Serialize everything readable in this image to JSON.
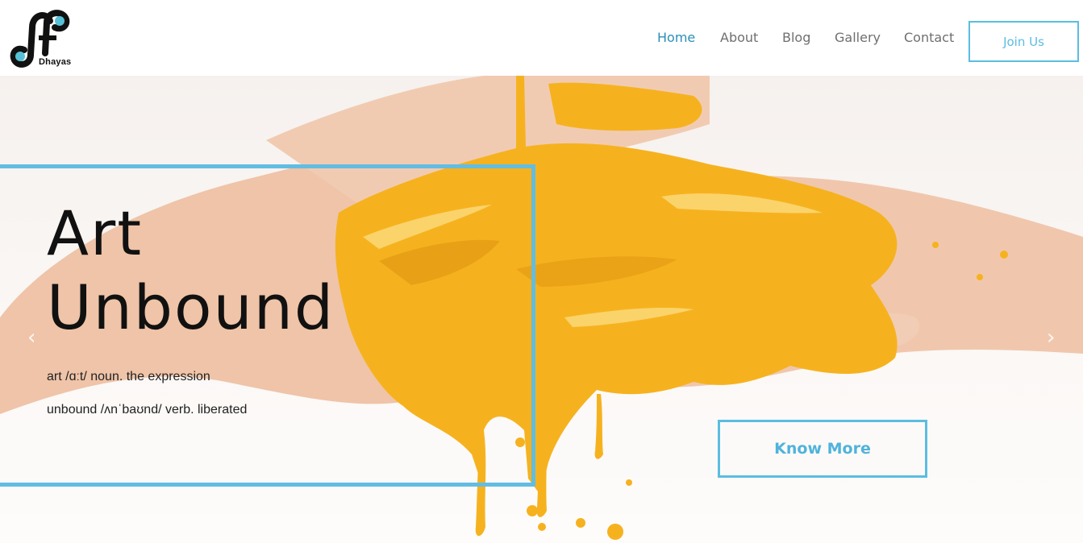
{
  "brand": {
    "name": "Dhayas",
    "logo_icon": "intertwined-jf-logo-icon"
  },
  "nav": {
    "items": [
      {
        "label": "Home",
        "active": true
      },
      {
        "label": "About",
        "active": false
      },
      {
        "label": "Blog",
        "active": false
      },
      {
        "label": "Gallery",
        "active": false
      },
      {
        "label": "Contact",
        "active": false
      }
    ],
    "join_label": "Join Us"
  },
  "hero": {
    "title_line1": "Art",
    "title_line2": "Unbound",
    "definition_1": "art /ɑːt/ noun. the expression",
    "definition_2": "unbound /ʌnˈbaʊnd/ verb. liberated",
    "cta_label": "Know More",
    "prev_icon": "chevron-left-icon",
    "next_icon": "chevron-right-icon",
    "prev_glyph": "‹",
    "next_glyph": "›",
    "image": "paint-covered-hands-photo"
  },
  "colors": {
    "accent": "#5bbde1",
    "nav_active": "#2a8fb8",
    "nav_text": "#6f6f6f",
    "paint": "#f6b21e",
    "skin": "#f0c7ad"
  }
}
